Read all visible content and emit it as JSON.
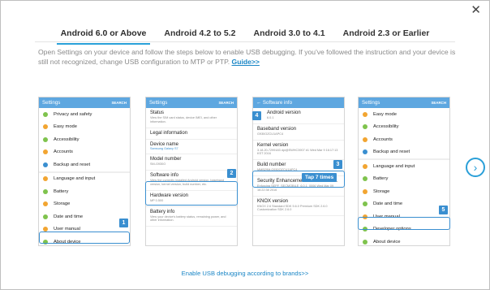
{
  "close_label": "✕",
  "tabs": [
    {
      "label": "Android 6.0 or Above"
    },
    {
      "label": "Android 4.2 to 5.2"
    },
    {
      "label": "Android 3.0 to 4.1"
    },
    {
      "label": "Android 2.3 or Earlier"
    }
  ],
  "intro": {
    "text": "Open Settings on your device and follow the steps below to enable USB debugging. If you've followed the instruction and your device is still not recognized, change USB configuration to MTP or PTP.",
    "guide_link": "Guide>>"
  },
  "phone1": {
    "title": "Settings",
    "search": "SEARCH",
    "rows": [
      "Privacy and safety",
      "Easy mode",
      "Accessibility",
      "Accounts",
      "Backup and reset",
      "Language and input",
      "Battery",
      "Storage",
      "Date and time",
      "User manual",
      "About device"
    ],
    "row_colors": [
      "#7fc34d",
      "#f2a531",
      "#7fc34d",
      "#f2a531",
      "#3a8fd0",
      "#f2a531",
      "#7fc34d",
      "#f2a531",
      "#7fc34d",
      "#f2a531",
      "#7fc34d"
    ],
    "badge": "1"
  },
  "phone2": {
    "title": "Settings",
    "search": "SEARCH",
    "items": [
      {
        "h": "Status",
        "d": "View the SIM card status, device IMEI, and other information."
      },
      {
        "h": "Legal information",
        "d": ""
      },
      {
        "h": "Device name",
        "v": "Samsung Galaxy S7"
      },
      {
        "h": "Model number",
        "d": "SM-G930O"
      },
      {
        "h": "Software info",
        "d": "View the currently installed Android version, baseband version, kernel version, build number, etc."
      },
      {
        "h": "Hardware version",
        "d": "MP 0.500"
      },
      {
        "h": "Battery info",
        "d": "View your device's battery status, remaining power, and other information."
      }
    ],
    "badge": "2"
  },
  "phone3": {
    "title": "Software info",
    "items": [
      {
        "h": "Android version",
        "d": "6.0.1"
      },
      {
        "h": "Baseband version",
        "d": "G930OZCU1APC4"
      },
      {
        "h": "Kernel version",
        "d": "3.18.20-7299183 dpi@SWHC3907 #1 Wed Mar 9 16:17:13 KST 2016"
      },
      {
        "h": "Build number",
        "d": "MMB29M.G930OZCU1APC4"
      },
      {
        "h": "Security Enhancements for Android...",
        "d": "Enforcing SEPF_SECMOBILE_6.0.1_0006 Wed Mar 09 16:22:38 2016"
      },
      {
        "h": "KNOX version",
        "d": "KNOX 2.6 Standard SDK 5.6.0 Premium SDK 2.6.0 Customization SDK 2.6.0"
      }
    ],
    "badge_top": "4",
    "badge_mid": "3",
    "tap": "Tap 7 times"
  },
  "phone4": {
    "title": "Settings",
    "search": "SEARCH",
    "rows": [
      "Easy mode",
      "Accessibility",
      "Accounts",
      "Backup and reset",
      "Language and input",
      "Battery",
      "Storage",
      "Date and time",
      "User manual",
      "Developer options",
      "About device"
    ],
    "row_colors": [
      "#f2a531",
      "#7fc34d",
      "#f2a531",
      "#3a8fd0",
      "#f2a531",
      "#7fc34d",
      "#f2a531",
      "#7fc34d",
      "#f2a531",
      "#7fc34d",
      "#7fc34d"
    ],
    "badge": "5"
  },
  "next_icon": "›",
  "brand_link": "Enable USB debugging according to brands>>"
}
